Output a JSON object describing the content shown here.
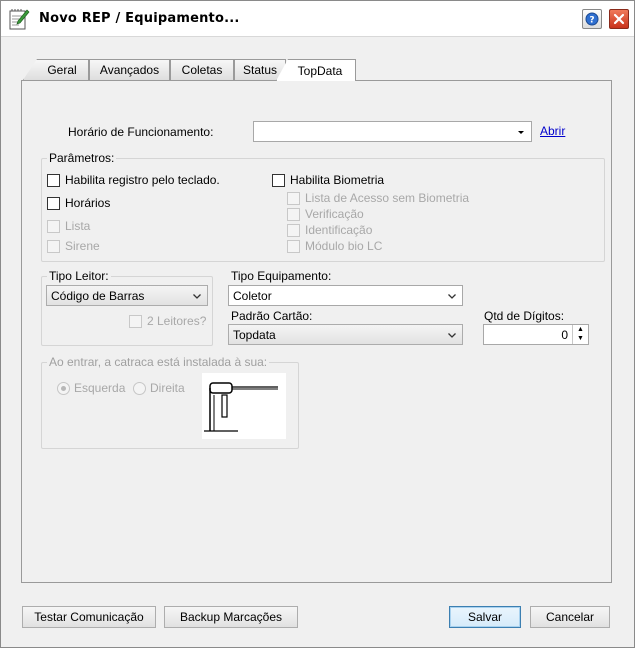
{
  "window": {
    "title": "Novo REP / Equipamento..."
  },
  "tabs": [
    {
      "label": "Geral"
    },
    {
      "label": "Avançados"
    },
    {
      "label": "Coletas"
    },
    {
      "label": "Status"
    },
    {
      "label": "TopData"
    }
  ],
  "horario": {
    "label": "Horário de Funcionamento:",
    "value": "",
    "link": "Abrir"
  },
  "parametros": {
    "title": "Parâmetros:",
    "habilita_teclado": "Habilita registro pelo teclado.",
    "horarios": "Horários",
    "lista": "Lista",
    "sirene": "Sirene",
    "habilita_biometria": "Habilita Biometria",
    "lista_acesso": "Lista de Acesso sem Biometria",
    "verificacao": "Verificação",
    "identificacao": "Identificação",
    "modulo_bio": "Módulo bio LC"
  },
  "tipo_leitor": {
    "title": "Tipo Leitor:",
    "value": "Código de Barras",
    "dois_leitores": "2 Leitores?"
  },
  "tipo_equipamento": {
    "label": "Tipo Equipamento:",
    "value": "Coletor"
  },
  "padrao_cartao": {
    "label": "Padrão Cartão:",
    "value": "Topdata"
  },
  "qtd_digitos": {
    "label": "Qtd de Dígitos:",
    "value": "0"
  },
  "catraca": {
    "title": "Ao entrar, a catraca está instalada à sua:",
    "esquerda": "Esquerda",
    "direita": "Direita"
  },
  "buttons": {
    "testar": "Testar Comunicação",
    "backup": "Backup Marcações",
    "salvar": "Salvar",
    "cancelar": "Cancelar"
  },
  "icons": {
    "app": "notepad-pencil-icon",
    "help": "help-icon",
    "close": "close-icon",
    "dropdown": "chevron-down-icon"
  }
}
